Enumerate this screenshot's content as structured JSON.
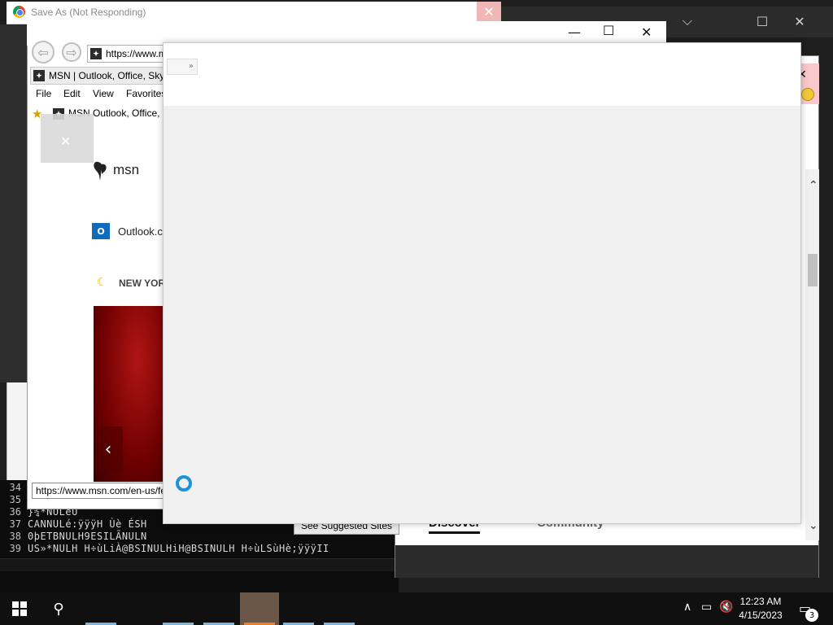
{
  "saveas": {
    "title": "Save As (Not Responding)",
    "close_glyph": "✕"
  },
  "dark_window": {
    "min_glyph": "⌵",
    "max_glyph": "☐",
    "close_glyph": "✕"
  },
  "ie": {
    "back_glyph": "⇦",
    "forward_glyph": "⇨",
    "address": "https://www.msn.com/en-us/",
    "tab_title": "MSN | Outlook, Office, Skype, Bing, Breaking News",
    "menu": {
      "file": "File",
      "edit": "Edit",
      "view": "View",
      "favorites": "Favorites"
    },
    "fav_item": "MSN  Outlook, Office, Skype",
    "logo_text": "msn",
    "outlook_text": "Outlook.com",
    "outlook_icon_letter": "O",
    "weather_text": "NEW YORK",
    "status_url": "https://www.msn.com/en-us/feed",
    "suggested_btn": "See Suggested Sites",
    "caption": {
      "min": "—",
      "max": "☐",
      "close": "✕"
    },
    "hero_prev": "‹",
    "grey_close": "✕"
  },
  "right_window": {
    "close_glyph": "✕",
    "up_glyph": "⌃",
    "down_glyph": "⌄",
    "tab_discover": "Discover",
    "tab_community": "Community"
  },
  "dialog": {
    "overflow_glyph": "»"
  },
  "console": {
    "lines": [
      {
        "num": "34",
        "text": ""
      },
      {
        "num": "35",
        "text": ""
      },
      {
        "num": "36",
        "text": "}¾*NULèÛ"
      },
      {
        "num": "37",
        "text": "CANNULé:ÿÿÿH Ùè ÉSH"
      },
      {
        "num": "38",
        "text": "0þETBNULH9ESILÃNULN"
      },
      {
        "num": "39",
        "text": "US»*NULH H÷ùLiÀ@BSINULHiH@BSINULH H÷ùLSùHè;ÿÿÿII"
      }
    ]
  },
  "taskbar": {
    "time": "12:23 AM",
    "date": "4/15/2023",
    "search_glyph": "⚲",
    "notif_count": "3",
    "tray": {
      "chevron": "∧",
      "network": "▭",
      "volume": "🔇"
    },
    "notif_glyph": "▭"
  }
}
